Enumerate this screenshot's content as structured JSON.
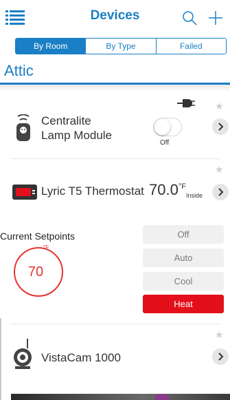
{
  "header": {
    "title": "Devices",
    "menu_icon": "list-menu-icon",
    "search_icon": "search-icon",
    "add_icon": "plus-icon"
  },
  "tabs": [
    {
      "label": "By Room",
      "active": true
    },
    {
      "label": "By Type",
      "active": false
    },
    {
      "label": "Failed",
      "active": false
    }
  ],
  "room": {
    "name": "Attic"
  },
  "devices": {
    "lamp": {
      "name_line1": "Centralite",
      "name_line2": "Lamp Module",
      "switch_state": "Off",
      "favorite": false,
      "icon": "lamp-module-icon"
    },
    "thermostat": {
      "name": "Lyric T5 Thermostat",
      "temperature": "70.0",
      "unit": "°F",
      "location": "Inside",
      "favorite": false,
      "icon": "thermostat-icon"
    },
    "camera": {
      "name": "VistaCam 1000",
      "favorite": false,
      "icon": "camera-icon"
    }
  },
  "setpoints": {
    "title": "Current Setpoints",
    "value": "70",
    "unit": "°F",
    "modes": [
      {
        "label": "Off",
        "active": false
      },
      {
        "label": "Auto",
        "active": false
      },
      {
        "label": "Cool",
        "active": false
      },
      {
        "label": "Heat",
        "active": true
      }
    ]
  },
  "colors": {
    "accent": "#1a7fc4",
    "heat": "#e3101b",
    "setpoint_ring": "#e3342f"
  }
}
